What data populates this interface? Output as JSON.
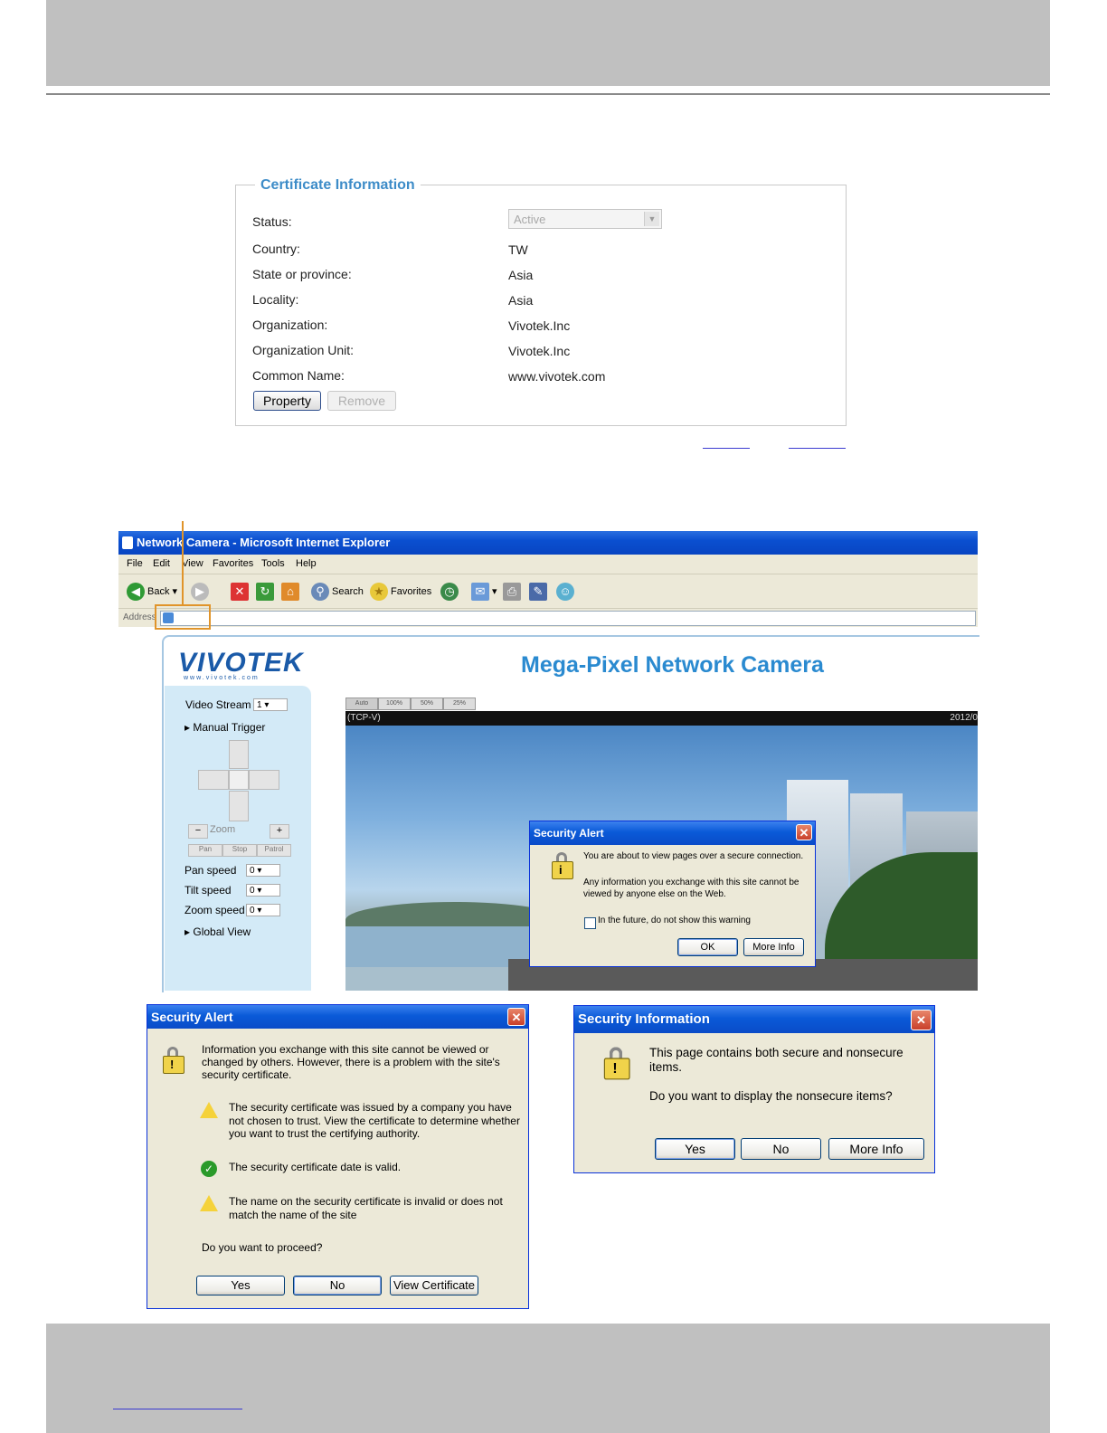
{
  "cert_panel": {
    "legend": "Certificate Information",
    "rows": [
      {
        "label": "Status:",
        "value": "Active"
      },
      {
        "label": "Country:",
        "value": "TW"
      },
      {
        "label": "State or province:",
        "value": "Asia"
      },
      {
        "label": "Locality:",
        "value": "Asia"
      },
      {
        "label": "Organization:",
        "value": "Vivotek.Inc"
      },
      {
        "label": "Organization Unit:",
        "value": "Vivotek.Inc"
      },
      {
        "label": "Common Name:",
        "value": "www.vivotek.com"
      }
    ],
    "property_button": "Property",
    "remove_button": "Remove"
  },
  "ie": {
    "title": "Network Camera - Microsoft Internet Explorer",
    "menu": [
      "File",
      "Edit",
      "View",
      "Favorites",
      "Tools",
      "Help"
    ],
    "toolbar": {
      "back": "Back",
      "search": "Search",
      "favorites": "Favorites"
    },
    "address_label": "Address"
  },
  "camera_page": {
    "logo": "VIVOTEK",
    "logo_sub": "www.vivotek.com",
    "title": "Mega-Pixel Network Camera",
    "video_stream_label": "Video Stream",
    "video_stream_value": "1",
    "manual_trigger": "Manual Trigger",
    "zoom": "Zoom",
    "pan_btn": "Pan",
    "stop_btn": "Stop",
    "patrol_btn": "Patrol",
    "pan_speed": "Pan speed",
    "tilt_speed": "Tilt speed",
    "zoom_speed": "Zoom speed",
    "speed_value": "0",
    "global_view": "Global View",
    "view_tabs": [
      "Auto",
      "100%",
      "50%",
      "25%"
    ],
    "stream_tag": "(TCP-V)",
    "timestamp": "2012/0"
  },
  "alert_small": {
    "title": "Security Alert",
    "line1": "You are about to view pages over a secure connection.",
    "line2": "Any information you exchange with this site cannot be viewed by anyone else on the Web.",
    "checkbox": "In the future, do not show this warning",
    "ok": "OK",
    "more_info": "More Info"
  },
  "alert_big": {
    "title": "Security Alert",
    "intro": "Information you exchange with this site cannot be viewed or changed by others. However, there is a problem with the site's security certificate.",
    "item1": "The security certificate was issued by a company you have not chosen to trust. View the certificate to determine whether you want to trust the certifying authority.",
    "item2": "The security certificate date is valid.",
    "item3": "The name on the security certificate is invalid or does not match the name of the site",
    "question": "Do you want to proceed?",
    "yes": "Yes",
    "no": "No",
    "view_cert": "View Certificate"
  },
  "security_info": {
    "title": "Security Information",
    "line1": "This page contains both secure and nonsecure items.",
    "line2": "Do you want to display the nonsecure items?",
    "yes": "Yes",
    "no": "No",
    "more_info": "More Info"
  }
}
